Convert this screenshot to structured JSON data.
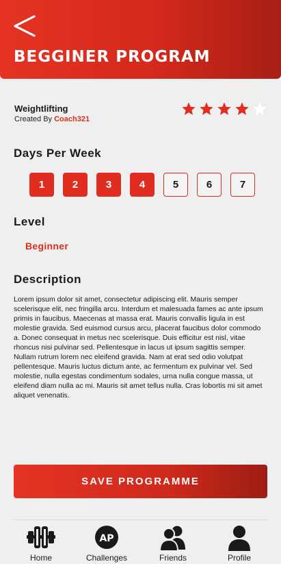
{
  "header": {
    "title": "BEGGINER PROGRAM",
    "back_icon": "back-arrow-icon"
  },
  "program": {
    "name": "Weightlifting",
    "created_by_prefix": "Created By",
    "coach": "Coach321",
    "rating": 4,
    "rating_max": 5
  },
  "days_section": {
    "title": "Days Per Week",
    "days": [
      {
        "label": "1",
        "selected": true
      },
      {
        "label": "2",
        "selected": true
      },
      {
        "label": "3",
        "selected": true
      },
      {
        "label": "4",
        "selected": true
      },
      {
        "label": "5",
        "selected": false
      },
      {
        "label": "6",
        "selected": false
      },
      {
        "label": "7",
        "selected": false
      }
    ]
  },
  "level_section": {
    "title": "Level",
    "value": "Beginner"
  },
  "description_section": {
    "title": "Description",
    "text": "Lorem ipsum dolor sit amet, consectetur adipiscing elit. Mauris semper scelerisque elit, nec fringilla arcu. Interdum et malesuada fames ac ante ipsum primis in faucibus. Maecenas at massa erat. Mauris convallis ligula in est molestie gravida. Sed euismod cursus arcu, placerat faucibus dolor commodo a. Donec consequat in metus nec scelerisque. Duis efficitur est nisl, vitae rhoncus nisi pulvinar sed. Pellentesque in lacus ut ipsum sagittis semper. Nullam rutrum lorem nec eleifend gravida. Nam at erat sed odio volutpat pellentesque. Mauris luctus dictum ante, ac fermentum ex pulvinar vel. Sed molestie, nulla egestas condimentum sodales, urna nulla congue massa, ut eleifend diam nulla ac mi. Mauris sit amet tellus nulla. Cras lobortis mi sit amet aliquet venenatis."
  },
  "save_button": {
    "label": "SAVE PROGRAMME"
  },
  "nav": {
    "items": [
      {
        "label": "Home",
        "icon": "dumbbell-icon"
      },
      {
        "label": "Challenges",
        "icon": "ap-badge-icon",
        "badge": "AP"
      },
      {
        "label": "Friends",
        "icon": "friends-icon"
      },
      {
        "label": "Profile",
        "icon": "profile-icon"
      }
    ]
  },
  "colors": {
    "accent": "#e02d1f",
    "accent_dark": "#9e1d14",
    "background": "#efefef",
    "star_empty": "#ffffff"
  }
}
